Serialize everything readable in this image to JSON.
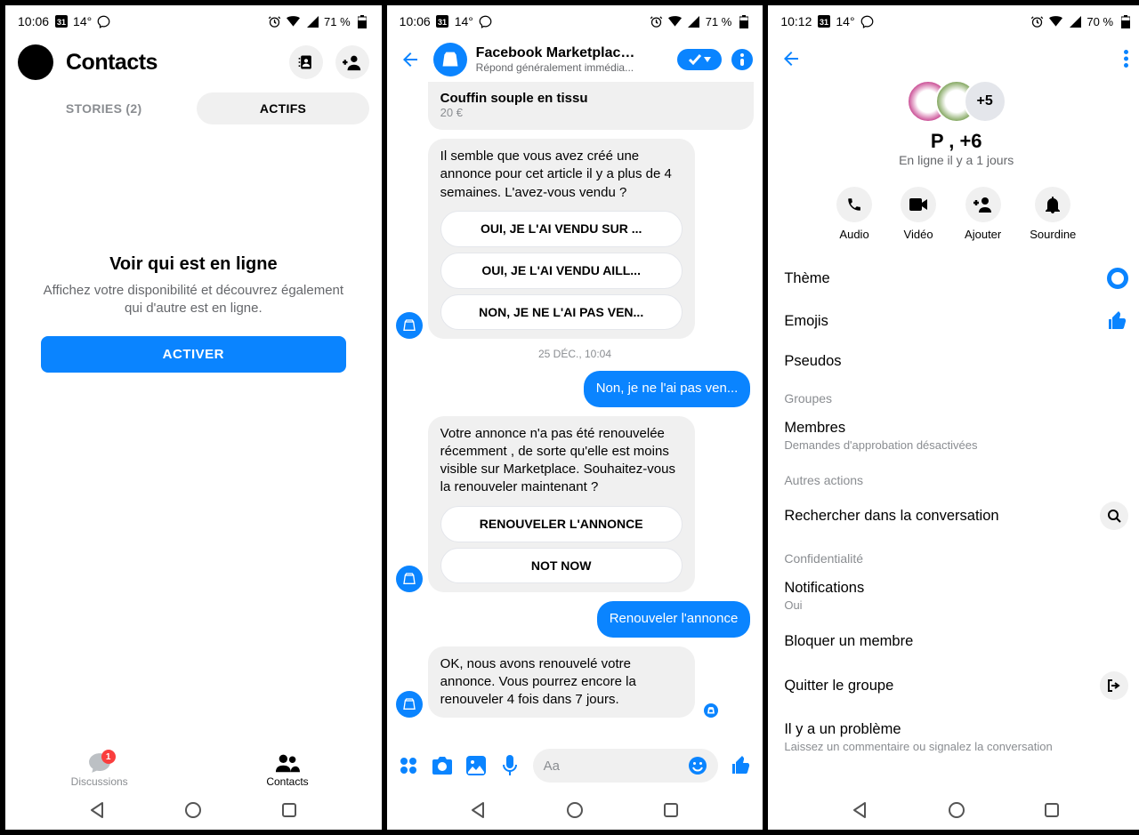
{
  "status": {
    "time1": "10:06",
    "time2": "10:06",
    "time3": "10:12",
    "temp": "14°",
    "date": "31",
    "bat1": "71 %",
    "bat2": "71 %",
    "bat3": "70 %"
  },
  "s1": {
    "title": "Contacts",
    "tab1": "STORIES (2)",
    "tab2": "ACTIFS",
    "heading": "Voir qui est en ligne",
    "desc": "Affichez votre disponibilité et découvrez également qui d'autre est en ligne.",
    "cta": "ACTIVER",
    "nav1": "Discussions",
    "nav2": "Contacts",
    "badge": "1"
  },
  "s2": {
    "title": "Facebook Marketplace...",
    "subtitle": "Répond généralement immédia...",
    "card_title": "Couffin souple en tissu",
    "card_price": "20 €",
    "msg1": "Il semble que vous avez créé une annonce pour cet article il y a plus de 4 semaines. L'avez-vous vendu ?",
    "opt1": "OUI, JE L'AI VENDU SUR ...",
    "opt2": "OUI, JE L'AI VENDU AILL...",
    "opt3": "NON, JE NE L'AI PAS VEN...",
    "ts": "25 DÉC., 10:04",
    "reply1": "Non, je ne l'ai pas ven...",
    "msg2": "Votre annonce n'a pas été renouvelée récemment , de sorte qu'elle est moins visible sur Marketplace. Souhaitez-vous la renouveler maintenant ?",
    "opt4": "RENOUVELER L'ANNONCE",
    "opt5": "NOT NOW",
    "reply2": "Renouveler l'annonce",
    "msg3": "OK, nous avons renouvelé votre annonce. Vous pourrez encore la renouveler 4 fois dans 7 jours.",
    "placeholder": "Aa"
  },
  "s3": {
    "more_avatars": "+5",
    "name": "P            , +6",
    "presence": "En ligne il y a 1      jours",
    "act1": "Audio",
    "act2": "Vidéo",
    "act3": "Ajouter",
    "act4": "Sourdine",
    "theme": "Thème",
    "emojis": "Emojis",
    "pseudos": "Pseudos",
    "groupes": "Groupes",
    "membres": "Membres",
    "membres_sub": "Demandes d'approbation désactivées",
    "autres": "Autres actions",
    "search": "Rechercher dans la conversation",
    "conf": "Confidentialité",
    "notif": "Notifications",
    "notif_sub": "Oui",
    "block": "Bloquer un membre",
    "leave": "Quitter le groupe",
    "problem": "Il y a un problème",
    "problem_sub": "Laissez un commentaire ou signalez la conversation"
  }
}
